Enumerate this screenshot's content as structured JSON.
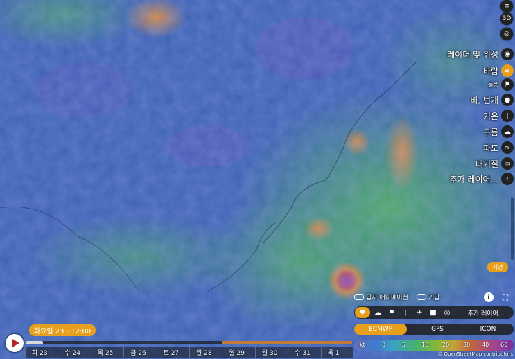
{
  "top_buttons": {
    "view_3d": "3D"
  },
  "layers": [
    {
      "label": "레이더 및 위성",
      "icon": "globe-icon"
    },
    {
      "label": "바람",
      "icon": "wind-icon",
      "active": true
    },
    {
      "label": "돌풍",
      "icon": "flag-icon",
      "small": true
    },
    {
      "label": "비, 번개",
      "icon": "drop-icon"
    },
    {
      "label": "기온",
      "icon": "thermometer-icon"
    },
    {
      "label": "구름",
      "icon": "cloud-icon"
    },
    {
      "label": "파도",
      "icon": "waves-icon"
    },
    {
      "label": "대기질",
      "icon": "car-icon"
    },
    {
      "label": "추가 레이어...",
      "icon": "chevron-left-icon"
    }
  ],
  "location_badge": "지면",
  "toggles": {
    "particles": "입자 애니메이션",
    "pressure": "기압"
  },
  "quick_icons": [
    "heart-icon",
    "clouds-icon",
    "flag-icon",
    "thermometer-icon",
    "plane-icon",
    "camera-icon",
    "hurricane-icon"
  ],
  "more_layers_btn": "추가 레이어...",
  "models": {
    "selected": "ECMWF",
    "list": [
      "ECMWF",
      "GFS",
      "ICON"
    ]
  },
  "legend": {
    "unit": "kt",
    "values": [
      "0",
      "5",
      "10",
      "20",
      "30",
      "40",
      "60"
    ]
  },
  "current_time": "화요일 23 - 12:00",
  "progress": 0.05,
  "days": [
    "화 23",
    "수 24",
    "목 25",
    "금 26",
    "토 27",
    "월 28",
    "월 29",
    "월 30",
    "수 31",
    "목 1"
  ],
  "attribution": "© OpenStreetMap contributors",
  "colors": {
    "accent": "#e6a01e",
    "dark": "#222222"
  }
}
